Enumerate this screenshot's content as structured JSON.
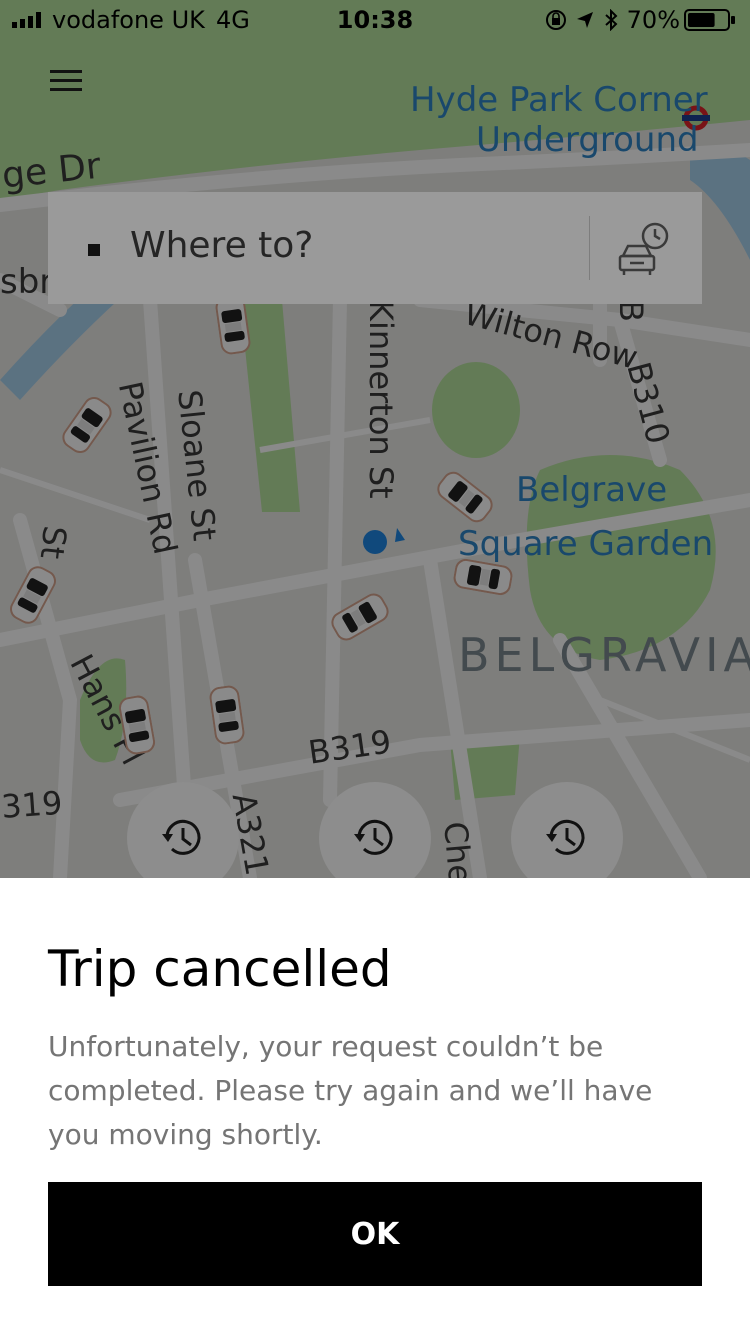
{
  "status_bar": {
    "carrier": "vodafone UK",
    "network": "4G",
    "time": "10:38",
    "battery": "70%",
    "battery_level": 0.7,
    "icons": [
      "orientation-lock-icon",
      "location-arrow-icon",
      "bluetooth-icon"
    ]
  },
  "map": {
    "labels": {
      "hyde_park_corner": "Hyde Park Corner",
      "underground": "Underground",
      "ge_dr": "ge Dr",
      "sbr": "sbr",
      "wilton_row": "Wilton Row",
      "kinnerton_st": "Kinnerton St",
      "b310": "B310",
      "b": "B",
      "pavilion_rd": "Pavilion Rd",
      "sloane_st": "Sloane St",
      "belgrave": "Belgrave",
      "square_garden": "Square Garden",
      "st": "St",
      "belgravia": "BELGRAVIA",
      "hans_pl": "Hans Pl",
      "b319": "B319",
      "r319": "319",
      "a321": "A321",
      "che": "Che"
    },
    "colors": {
      "land": "#e9e9e6",
      "park": "#b8e3a0",
      "water": "#a9d3ef",
      "road": "#ffffff",
      "scrim": "rgba(0,0,0,0.46)"
    }
  },
  "search": {
    "placeholder": "Where to?",
    "icon": "schedule-car-icon"
  },
  "recent_buttons": [
    {
      "icon": "history-clock-icon"
    },
    {
      "icon": "history-clock-icon"
    },
    {
      "icon": "history-clock-icon"
    }
  ],
  "dialog": {
    "title": "Trip cancelled",
    "message": "Unfortunately, your request couldn’t be completed. Please try again and we’ll have you moving shortly.",
    "ok_label": "OK"
  }
}
